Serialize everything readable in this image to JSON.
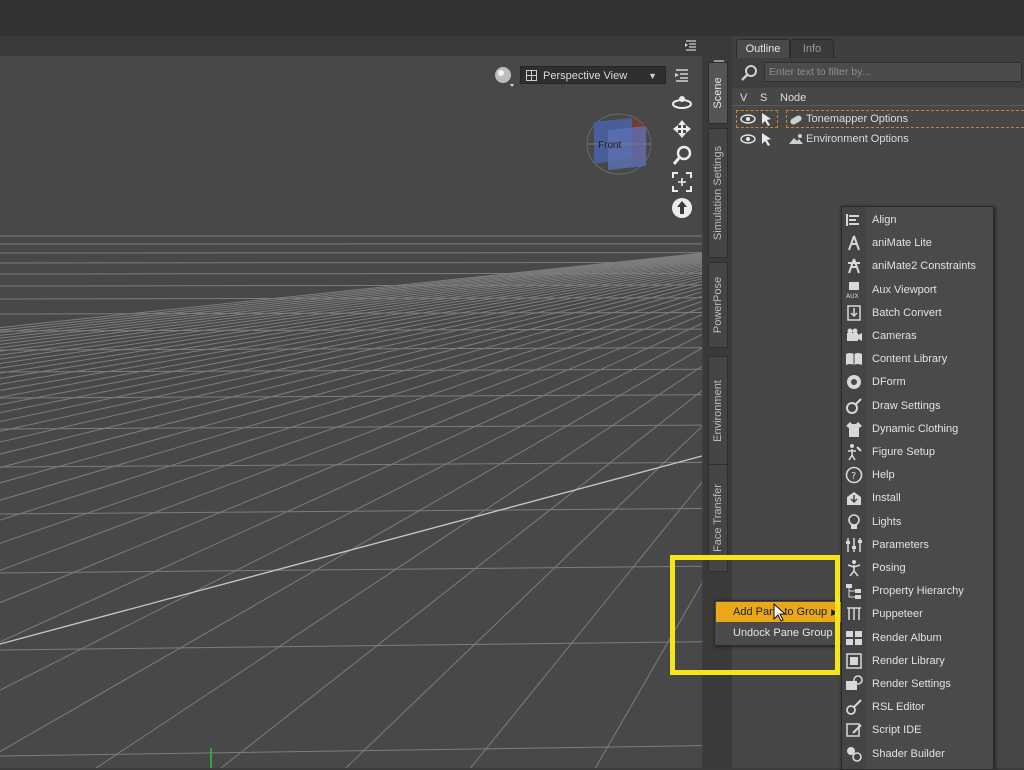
{
  "viewport": {
    "view_label": "Perspective View",
    "cube_face_label": "Front"
  },
  "tabs_vertical": [
    "Scene",
    "Simulation Settings",
    "PowerPose",
    "Environment",
    "Face Transfer"
  ],
  "pane": {
    "tabs": [
      "Outline",
      "Info"
    ],
    "filter_placeholder": "Enter text to filter by...",
    "columns": {
      "v": "V",
      "s": "S",
      "node": "Node"
    },
    "nodes": [
      "Tonemapper Options",
      "Environment Options"
    ]
  },
  "context_menu": {
    "items": [
      "Add Pane to Group",
      "Undock Pane Group"
    ]
  },
  "submenu": {
    "items": [
      {
        "label": "Align",
        "icon": "align-icon"
      },
      {
        "label": "aniMate Lite",
        "icon": "animate-icon"
      },
      {
        "label": "aniMate2 Constraints",
        "icon": "animate2-icon"
      },
      {
        "label": "Aux Viewport",
        "icon": "aux-viewport-icon"
      },
      {
        "label": "Batch Convert",
        "icon": "batch-convert-icon"
      },
      {
        "label": "Cameras",
        "icon": "camera-icon"
      },
      {
        "label": "Content Library",
        "icon": "book-icon"
      },
      {
        "label": "DForm",
        "icon": "dform-icon"
      },
      {
        "label": "Draw Settings",
        "icon": "draw-settings-icon"
      },
      {
        "label": "Dynamic Clothing",
        "icon": "shirt-icon"
      },
      {
        "label": "Figure Setup",
        "icon": "figure-setup-icon"
      },
      {
        "label": "Help",
        "icon": "help-icon"
      },
      {
        "label": "Install",
        "icon": "install-icon"
      },
      {
        "label": "Lights",
        "icon": "light-icon"
      },
      {
        "label": "Parameters",
        "icon": "sliders-icon"
      },
      {
        "label": "Posing",
        "icon": "posing-icon"
      },
      {
        "label": "Property Hierarchy",
        "icon": "hierarchy-icon"
      },
      {
        "label": "Puppeteer",
        "icon": "puppeteer-icon"
      },
      {
        "label": "Render Album",
        "icon": "album-icon"
      },
      {
        "label": "Render Library",
        "icon": "render-library-icon"
      },
      {
        "label": "Render Settings",
        "icon": "render-settings-icon"
      },
      {
        "label": "RSL Editor",
        "icon": "rsl-editor-icon"
      },
      {
        "label": "Script IDE",
        "icon": "script-ide-icon"
      },
      {
        "label": "Shader Builder",
        "icon": "shader-builder-icon"
      }
    ]
  },
  "colors": {
    "highlight": "#e8a817",
    "annotation_box": "#f5e61a",
    "viewport_bg": "#484848"
  }
}
